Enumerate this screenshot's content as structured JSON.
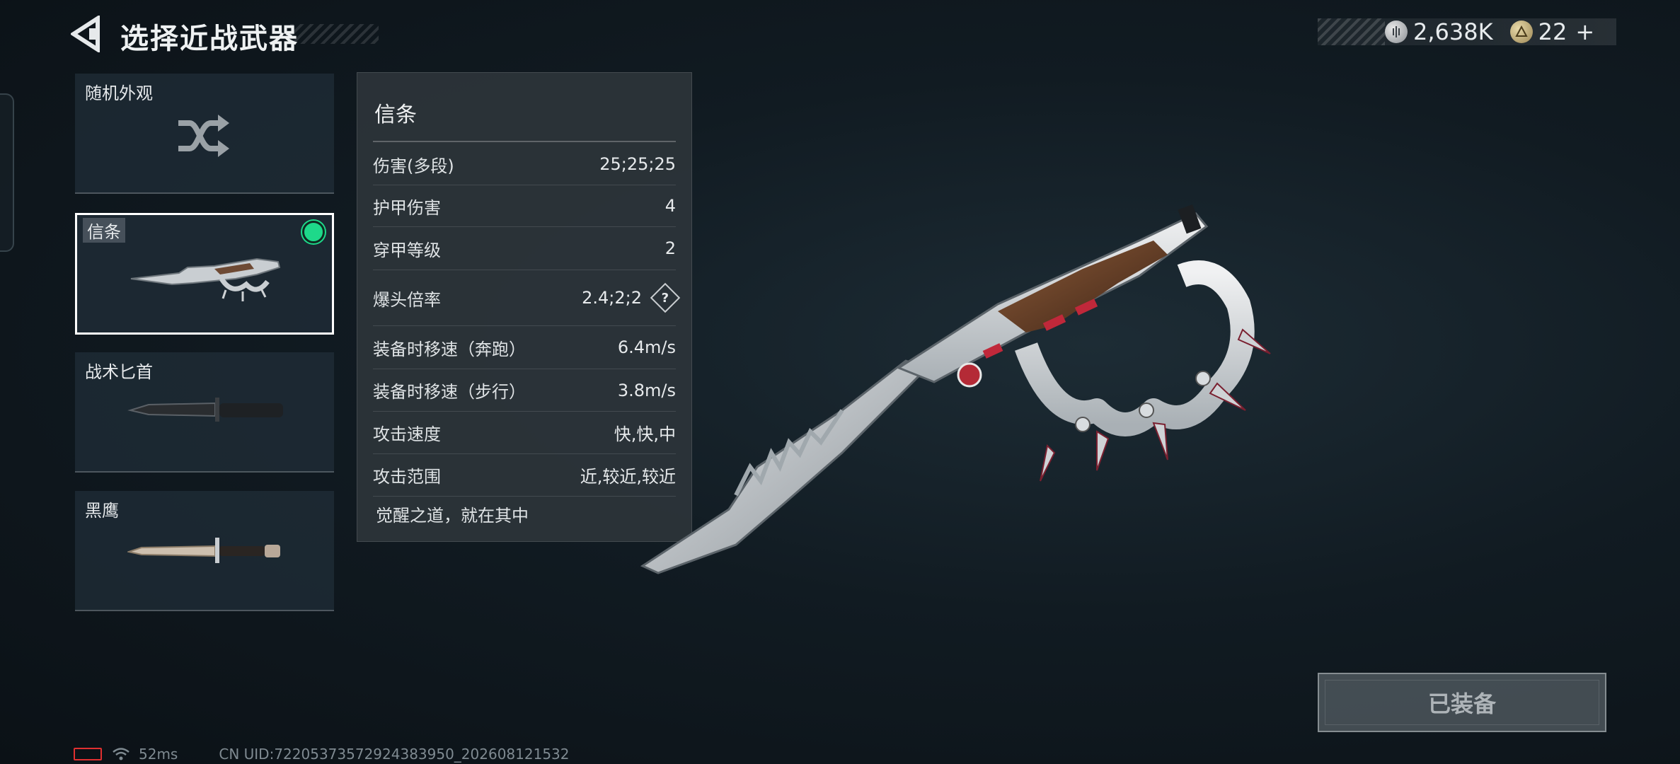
{
  "header": {
    "title": "选择近战武器"
  },
  "currency": {
    "silver_value": "2,638K",
    "gold_value": "22",
    "add_symbol": "+"
  },
  "sidebar": {
    "items": [
      {
        "label": "随机外观",
        "icon": "shuffle-icon"
      },
      {
        "label": "信条",
        "icon": "knuckle-knife-thumbnail",
        "selected": true,
        "equipped": true
      },
      {
        "label": "战术匕首",
        "icon": "tactical-dagger-thumbnail"
      },
      {
        "label": "黑鹰",
        "icon": "black-eagle-knife-thumbnail"
      }
    ]
  },
  "stats": {
    "title": "信条",
    "rows": [
      {
        "label": "伤害(多段)",
        "value": "25;25;25"
      },
      {
        "label": "护甲伤害",
        "value": "4"
      },
      {
        "label": "穿甲等级",
        "value": "2"
      },
      {
        "label": "爆头倍率",
        "value": "2.4;2;2",
        "help": "?"
      },
      {
        "label": "装备时移速（奔跑）",
        "value": "6.4m/s"
      },
      {
        "label": "装备时移速（步行）",
        "value": "3.8m/s"
      },
      {
        "label": "攻击速度",
        "value": "快,快,中"
      },
      {
        "label": "攻击范围",
        "value": "近,较近,较近"
      }
    ],
    "flavor": "觉醒之道，就在其中"
  },
  "equip_button": {
    "label": "已装备"
  },
  "status": {
    "ping": "52ms",
    "uid": "CN UID:72205373572924383950_202608121532"
  },
  "colors": {
    "equipped_dot": "#1ed98a",
    "accent_red": "#c0283a",
    "battery_red": "#e03030"
  }
}
